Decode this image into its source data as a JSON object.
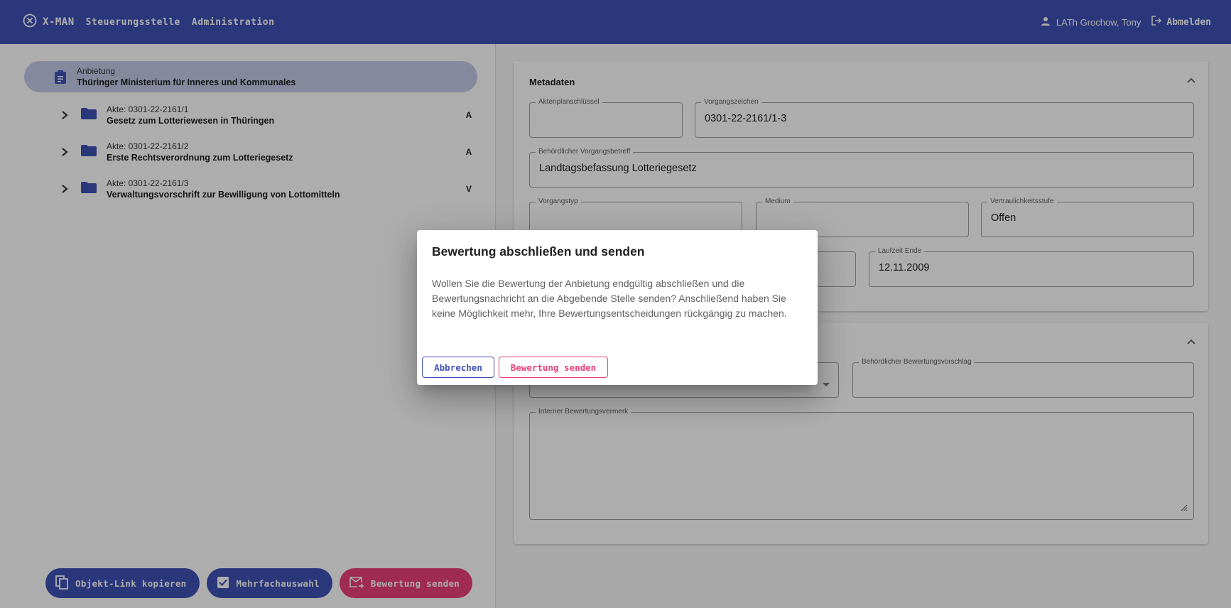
{
  "colors": {
    "primary": "#3f51b5",
    "accent": "#ec407a",
    "selected": "#c5cae9"
  },
  "header": {
    "brand": "X-MAN",
    "nav": [
      "Steuerungsstelle",
      "Administration"
    ],
    "user": "LATh Grochow, Tony",
    "logout": "Abmelden"
  },
  "tree": {
    "root": {
      "label": "Anbietung",
      "name": "Thüringer Ministerium für Inneres und Kommunales"
    },
    "items": [
      {
        "akte": "Akte: 0301-22-2161/1",
        "title": "Gesetz zum Lotteriewesen in Thüringen",
        "letter": "A"
      },
      {
        "akte": "Akte: 0301-22-2161/2",
        "title": "Erste Rechtsverordnung zum Lotteriegesetz",
        "letter": "A"
      },
      {
        "akte": "Akte: 0301-22-2161/3",
        "title": "Verwaltungsvorschrift zur Bewilligung von Lottomitteln",
        "letter": "V"
      }
    ]
  },
  "actions": {
    "copy_link": "Objekt-Link kopieren",
    "multi_select": "Mehrfachauswahl",
    "send_rating": "Bewertung senden"
  },
  "metadata": {
    "title": "Metadaten",
    "aktenplanschluessel": {
      "label": "Aktenplanschlüssel",
      "value": ""
    },
    "vorgangszeichen": {
      "label": "Vorgangszeichen",
      "value": "0301-22-2161/1-3"
    },
    "betreff": {
      "label": "Behördlicher Vorgangsbetreff",
      "value": "Landtagsbefassung Lotteriegesetz"
    },
    "vorgangstyp": {
      "label": "Vorgangstyp",
      "value": ""
    },
    "medium": {
      "label": "Medium",
      "value": ""
    },
    "vertraulichkeit": {
      "label": "Vertraulichkeitsstufe",
      "value": "Offen"
    },
    "laufzeit_ende": {
      "label": "Laufzeit Ende",
      "value": "12.11.2009"
    }
  },
  "rating": {
    "vorschlag": {
      "label": "Behördlicher Bewertungsvorschlag",
      "value": ""
    },
    "vermerk": {
      "label": "Interner Bewertungsvermerk",
      "value": ""
    }
  },
  "dialog": {
    "title": "Bewertung abschließen und senden",
    "body": "Wollen Sie die Bewertung der Anbietung endgültig abschließen und die Bewertungsnachricht an die Abgebende Stelle senden? Anschließend haben Sie keine Möglichkeit mehr, Ihre Bewertungsentscheidungen rückgängig zu machen.",
    "cancel": "Abbrechen",
    "confirm": "Bewertung senden"
  }
}
